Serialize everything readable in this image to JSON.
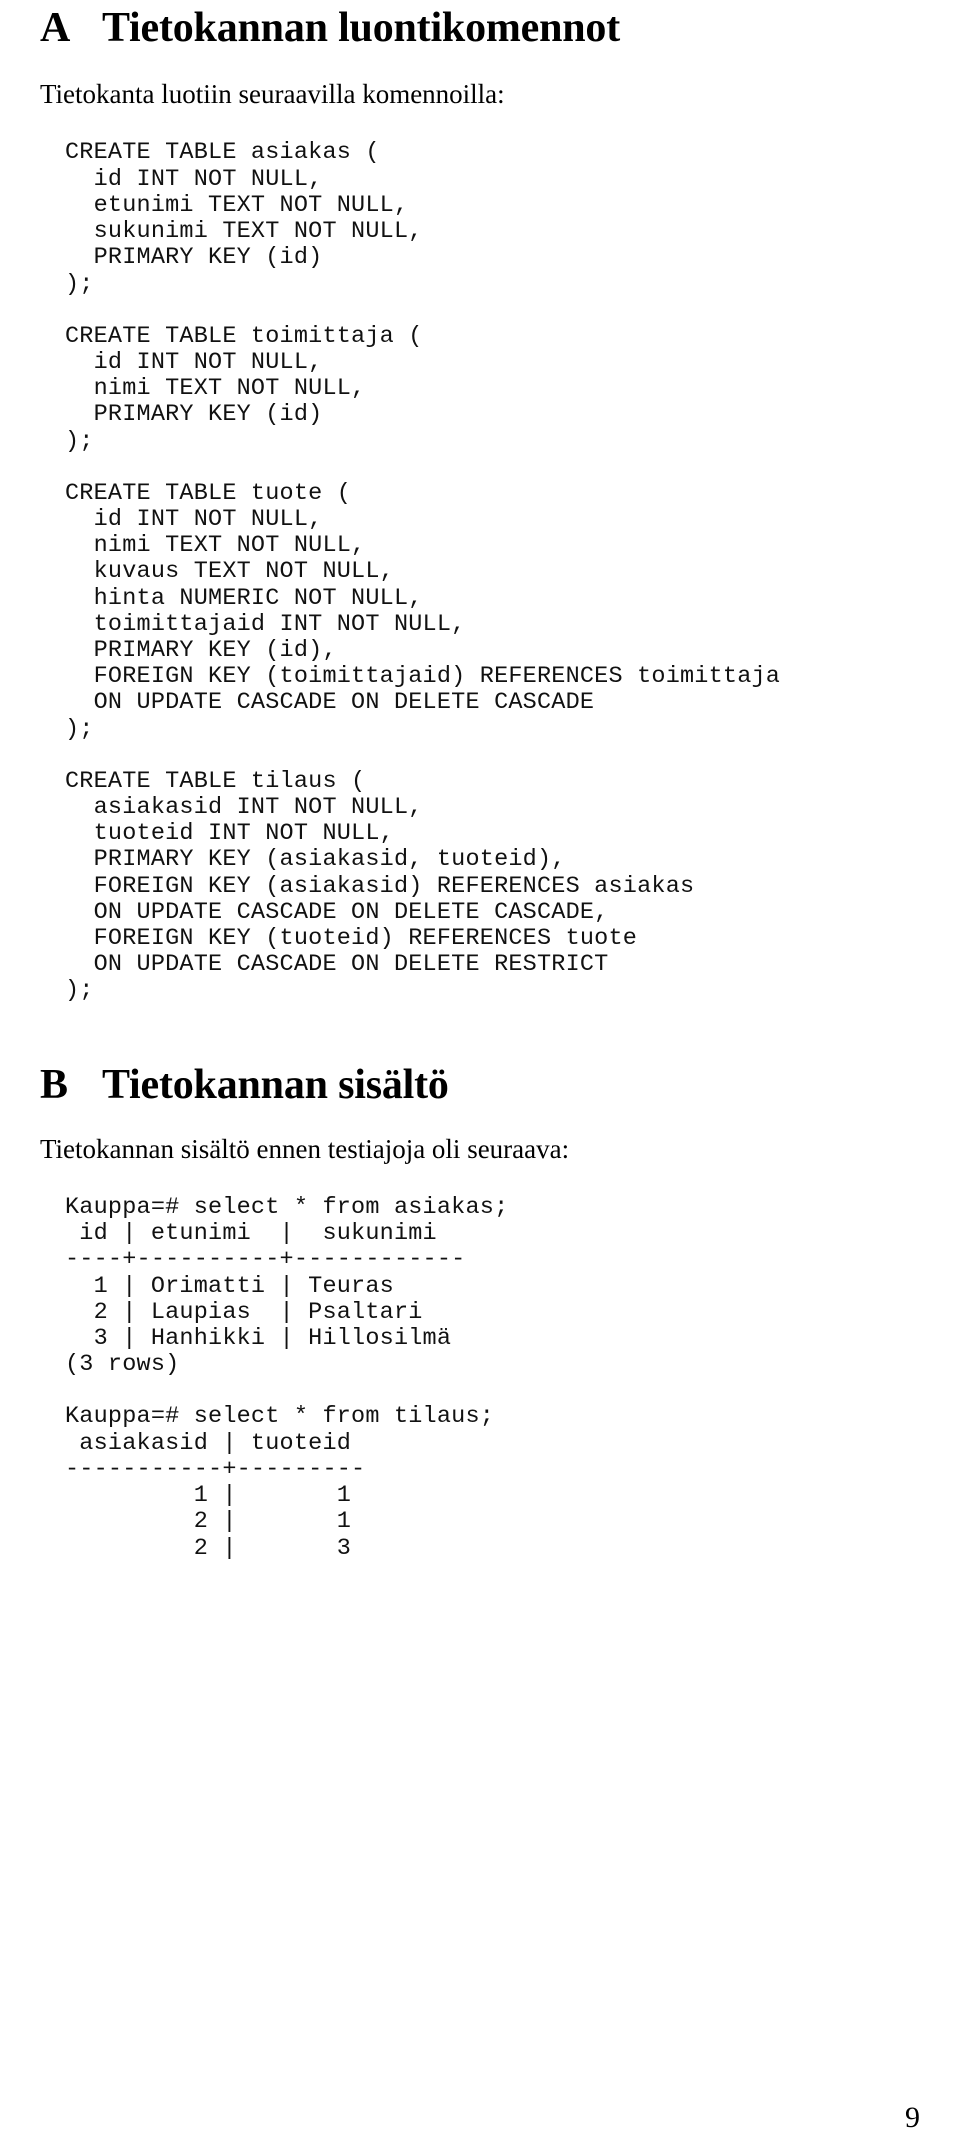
{
  "document": {
    "page_number": "9"
  },
  "section_a": {
    "letter": "A",
    "title": "Tietokannan luontikomennot",
    "intro": "Tietokanta luotiin seuraavilla komennoilla:",
    "code_blocks": [
      "CREATE TABLE asiakas (\n  id INT NOT NULL,\n  etunimi TEXT NOT NULL,\n  sukunimi TEXT NOT NULL,\n  PRIMARY KEY (id)\n);",
      "CREATE TABLE toimittaja (\n  id INT NOT NULL,\n  nimi TEXT NOT NULL,\n  PRIMARY KEY (id)\n);",
      "CREATE TABLE tuote (\n  id INT NOT NULL,\n  nimi TEXT NOT NULL,\n  kuvaus TEXT NOT NULL,\n  hinta NUMERIC NOT NULL,\n  toimittajaid INT NOT NULL,\n  PRIMARY KEY (id),\n  FOREIGN KEY (toimittajaid) REFERENCES toimittaja\n  ON UPDATE CASCADE ON DELETE CASCADE\n);",
      "CREATE TABLE tilaus (\n  asiakasid INT NOT NULL,\n  tuoteid INT NOT NULL,\n  PRIMARY KEY (asiakasid, tuoteid),\n  FOREIGN KEY (asiakasid) REFERENCES asiakas\n  ON UPDATE CASCADE ON DELETE CASCADE,\n  FOREIGN KEY (tuoteid) REFERENCES tuote\n  ON UPDATE CASCADE ON DELETE RESTRICT\n);"
    ]
  },
  "section_b": {
    "letter": "B",
    "title": "Tietokannan sisältö",
    "intro": "Tietokannan sisältö ennen testiajoja oli seuraava:",
    "output_blocks": [
      "Kauppa=# select * from asiakas;\n id | etunimi  |  sukunimi\n----+----------+------------\n  1 | Orimatti | Teuras\n  2 | Laupias  | Psaltari\n  3 | Hanhikki | Hillosilmä\n(3 rows)",
      "Kauppa=# select * from tilaus;\n asiakasid | tuoteid\n-----------+---------\n         1 |       1\n         2 |       1\n         2 |       3"
    ]
  }
}
